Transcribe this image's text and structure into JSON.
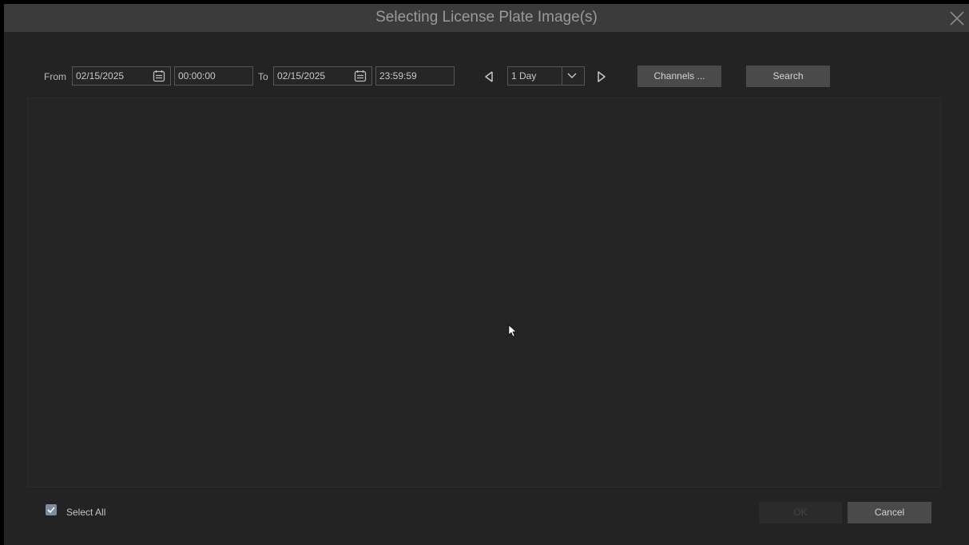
{
  "dialog": {
    "title": "Selecting License Plate Image(s)"
  },
  "filter": {
    "from_label": "From",
    "from_date": "02/15/2025",
    "from_time": "00:00:00",
    "to_label": "To",
    "to_date": "02/15/2025",
    "to_time": "23:59:59",
    "period_value": "1 Day",
    "channels_label": "Channels ...",
    "search_label": "Search"
  },
  "footer": {
    "select_all_label": "Select All",
    "select_all_checked": true,
    "ok_label": "OK",
    "cancel_label": "Cancel"
  },
  "icons": {
    "close": "close-icon",
    "calendar": "calendar-icon",
    "prev": "triangle-left-icon",
    "next": "triangle-right-icon",
    "dropdown": "chevron-down-icon",
    "check": "check-icon"
  },
  "colors": {
    "background": "#232323",
    "titlebar": "#3b3b3b",
    "button": "#4a4a4a",
    "checkbox": "#7d8da0"
  }
}
